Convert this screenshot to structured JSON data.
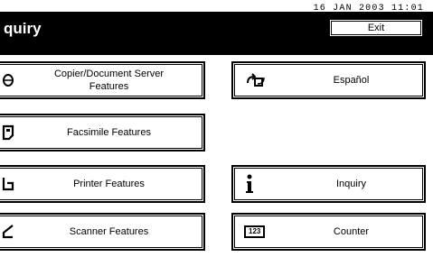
{
  "header": {
    "datetime": "16 JAN  2003 11:01",
    "title": "quiry",
    "exit_label": "Exit"
  },
  "left_menu": [
    {
      "label": "Copier/Document Server\nFeatures",
      "icon": "copier-icon"
    },
    {
      "label": "Facsimile Features",
      "icon": "fax-icon"
    },
    {
      "label": "Printer Features",
      "icon": "printer-icon"
    },
    {
      "label": "Scanner Features",
      "icon": "scanner-icon"
    }
  ],
  "right_menu": [
    {
      "label": "Español",
      "icon": "language-icon"
    },
    {
      "label": "Inquiry",
      "icon": "info-icon"
    },
    {
      "label": "Counter",
      "icon": "counter-icon",
      "icon_text": "123"
    }
  ]
}
